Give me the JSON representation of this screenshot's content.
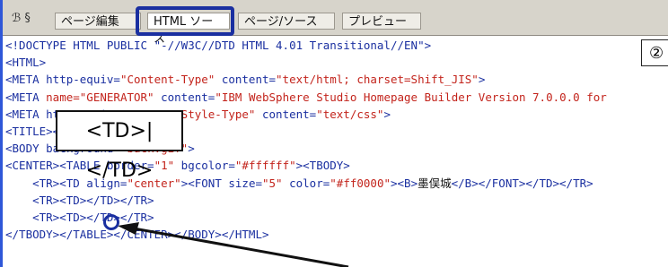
{
  "tabs": {
    "icons": "ℬ §",
    "page_edit": "ページ編集",
    "html_source": "HTML ソース",
    "page_source": "ページ/ソース",
    "preview": "プレビュー"
  },
  "code_lines": [
    [
      {
        "t": "<!DOCTYPE HTML PUBLIC \"-//W3C//DTD HTML 4.01 Transitional//EN\">",
        "c": "tag"
      }
    ],
    [
      {
        "t": "<HTML>",
        "c": "tag"
      }
    ],
    [
      {
        "t": "<META http-equiv=",
        "c": "tag"
      },
      {
        "t": "\"Content-Type\"",
        "c": "str"
      },
      {
        "t": " content=",
        "c": "tag"
      },
      {
        "t": "\"text/html; charset=Shift_JIS\"",
        "c": "str"
      },
      {
        "t": ">",
        "c": "tag"
      }
    ],
    [
      {
        "t": "<META ",
        "c": "tag"
      },
      {
        "t": "name=\"GENERATOR\"",
        "c": "str"
      },
      {
        "t": " content=",
        "c": "tag"
      },
      {
        "t": "\"IBM WebSphere Studio Homepage Builder Version 7.0.0.0 for",
        "c": "str"
      }
    ],
    [
      {
        "t": "<META ",
        "c": "tag"
      },
      {
        "t": "http-equiv=\"Content-",
        "c": "tag"
      },
      {
        "t": "Style-Type\"",
        "c": "str"
      },
      {
        "t": " content=",
        "c": "tag"
      },
      {
        "t": "\"text/css\"",
        "c": "str"
      },
      {
        "t": ">",
        "c": "tag"
      }
    ],
    [
      {
        "t": "<TITLE></TITLE>",
        "c": "tag"
      }
    ],
    [
      {
        "t": "<BODY background=",
        "c": "tag"
      },
      {
        "t": "\"back.gif\"",
        "c": "str"
      },
      {
        "t": ">",
        "c": "tag"
      }
    ],
    [
      {
        "t": "<CENTER><TABLE border=",
        "c": "tag"
      },
      {
        "t": "\"1\"",
        "c": "str"
      },
      {
        "t": " bgcolor=",
        "c": "tag"
      },
      {
        "t": "\"#ffffff\"",
        "c": "str"
      },
      {
        "t": "><TBODY>",
        "c": "tag"
      }
    ],
    [
      {
        "t": "    <TR><TD align=",
        "c": "tag"
      },
      {
        "t": "\"center\"",
        "c": "str"
      },
      {
        "t": "><FONT size=",
        "c": "tag"
      },
      {
        "t": "\"5\"",
        "c": "str"
      },
      {
        "t": " color=",
        "c": "tag"
      },
      {
        "t": "\"#ff0000\"",
        "c": "str"
      },
      {
        "t": "><B>",
        "c": "tag"
      },
      {
        "t": "墨俣城",
        "c": "txt"
      },
      {
        "t": "</B></FONT></TD></TR>",
        "c": "tag"
      }
    ],
    [
      {
        "t": "    <TR><TD></TD></TR>",
        "c": "tag"
      }
    ],
    [
      {
        "t": "    <TR><TD></TD></TR>",
        "c": "tag"
      }
    ],
    [
      {
        "t": "</TBODY></TABLE></CENTER></BODY></HTML>",
        "c": "tag"
      }
    ]
  ],
  "annotations": {
    "number_label": "②",
    "callout_text": "<TD>|</TD>"
  }
}
